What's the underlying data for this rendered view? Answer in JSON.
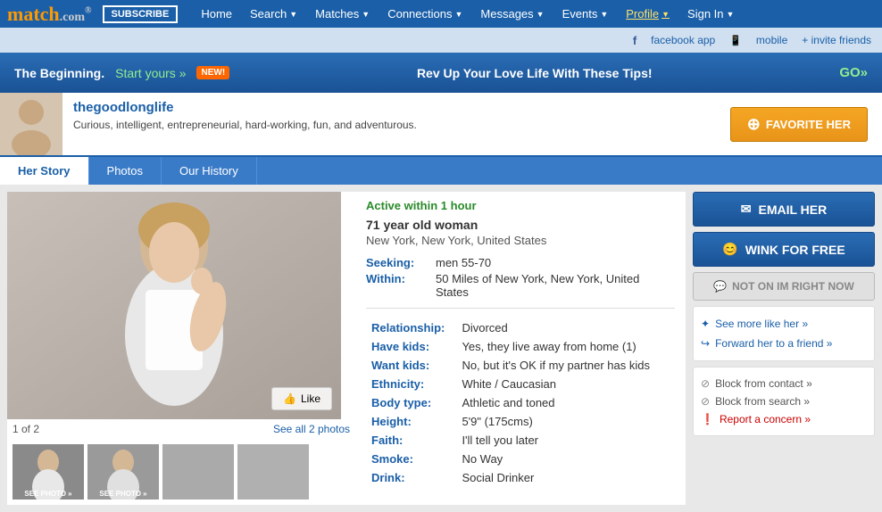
{
  "nav": {
    "logo": "match",
    "logo_suffix": ".com",
    "subscribe_label": "SUBSCRIBE",
    "links": [
      {
        "label": "Home",
        "id": "home",
        "has_arrow": false
      },
      {
        "label": "Search",
        "id": "search",
        "has_arrow": true
      },
      {
        "label": "Matches",
        "id": "matches",
        "has_arrow": true
      },
      {
        "label": "Connections",
        "id": "connections",
        "has_arrow": true
      },
      {
        "label": "Messages",
        "id": "messages",
        "has_arrow": true
      },
      {
        "label": "Events",
        "id": "events",
        "has_arrow": true
      },
      {
        "label": "Profile",
        "id": "profile",
        "has_arrow": true,
        "active": true
      },
      {
        "label": "Sign In",
        "id": "sign-in",
        "has_arrow": true
      }
    ]
  },
  "social_bar": {
    "facebook_label": "facebook app",
    "mobile_label": "mobile",
    "invite_label": "+ invite friends"
  },
  "promo": {
    "beginning_text": "The Beginning.",
    "start_yours": "Start yours »",
    "new_badge": "NEW!",
    "promo_text": "Rev Up Your Love Life With These Tips!",
    "go_label": "GO»"
  },
  "profile_header": {
    "username": "thegoodlonglife",
    "tagline": "Curious, intelligent, entrepreneurial, hard-working, fun, and adventurous.",
    "favorite_label": "FAVORITE HER"
  },
  "tabs": [
    {
      "label": "Her Story",
      "id": "her-story",
      "active": true
    },
    {
      "label": "Photos",
      "id": "photos",
      "active": false
    },
    {
      "label": "Our History",
      "id": "our-history",
      "active": false
    }
  ],
  "profile": {
    "active_status": "Active within 1 hour",
    "age_info": "71 year old woman",
    "location": "New York, New York, United States",
    "seeking_label": "Seeking:",
    "seeking_value": "men 55-70",
    "within_label": "Within:",
    "within_value": "50 Miles of New York, New York, United States",
    "details": [
      {
        "label": "Relationship:",
        "value": "Divorced"
      },
      {
        "label": "Have kids:",
        "value": "Yes, they live away from home (1)"
      },
      {
        "label": "Want kids:",
        "value": "No, but it's OK if my partner has kids"
      },
      {
        "label": "Ethnicity:",
        "value": "White / Caucasian"
      },
      {
        "label": "Body type:",
        "value": "Athletic and toned"
      },
      {
        "label": "Height:",
        "value": "5'9\" (175cms)"
      },
      {
        "label": "Faith:",
        "value": "I'll tell you later"
      },
      {
        "label": "Smoke:",
        "value": "No Way"
      },
      {
        "label": "Drink:",
        "value": "Social Drinker"
      }
    ]
  },
  "photos": {
    "counter": "1 of 2",
    "see_all": "See all 2 photos",
    "like_label": "Like",
    "thumbs": [
      {
        "label": "SEE PHOTO »",
        "active": true
      },
      {
        "label": "SEE PHOTO »",
        "active": false
      },
      {
        "label": "",
        "active": false
      },
      {
        "label": "",
        "active": false
      }
    ]
  },
  "sidebar": {
    "email_label": "EMAIL HER",
    "wink_label": "WINK FOR FREE",
    "im_label": "NOT ON IM RIGHT NOW",
    "action_links": [
      {
        "label": "See more like her »",
        "icon": "plus"
      },
      {
        "label": "Forward her to a friend »",
        "icon": "arrow"
      }
    ],
    "block_links": [
      {
        "label": "Block from contact »",
        "icon": "circle",
        "color": "gray"
      },
      {
        "label": "Block from search »",
        "icon": "circle",
        "color": "gray"
      },
      {
        "label": "Report a concern »",
        "icon": "exclamation",
        "color": "red"
      }
    ]
  }
}
